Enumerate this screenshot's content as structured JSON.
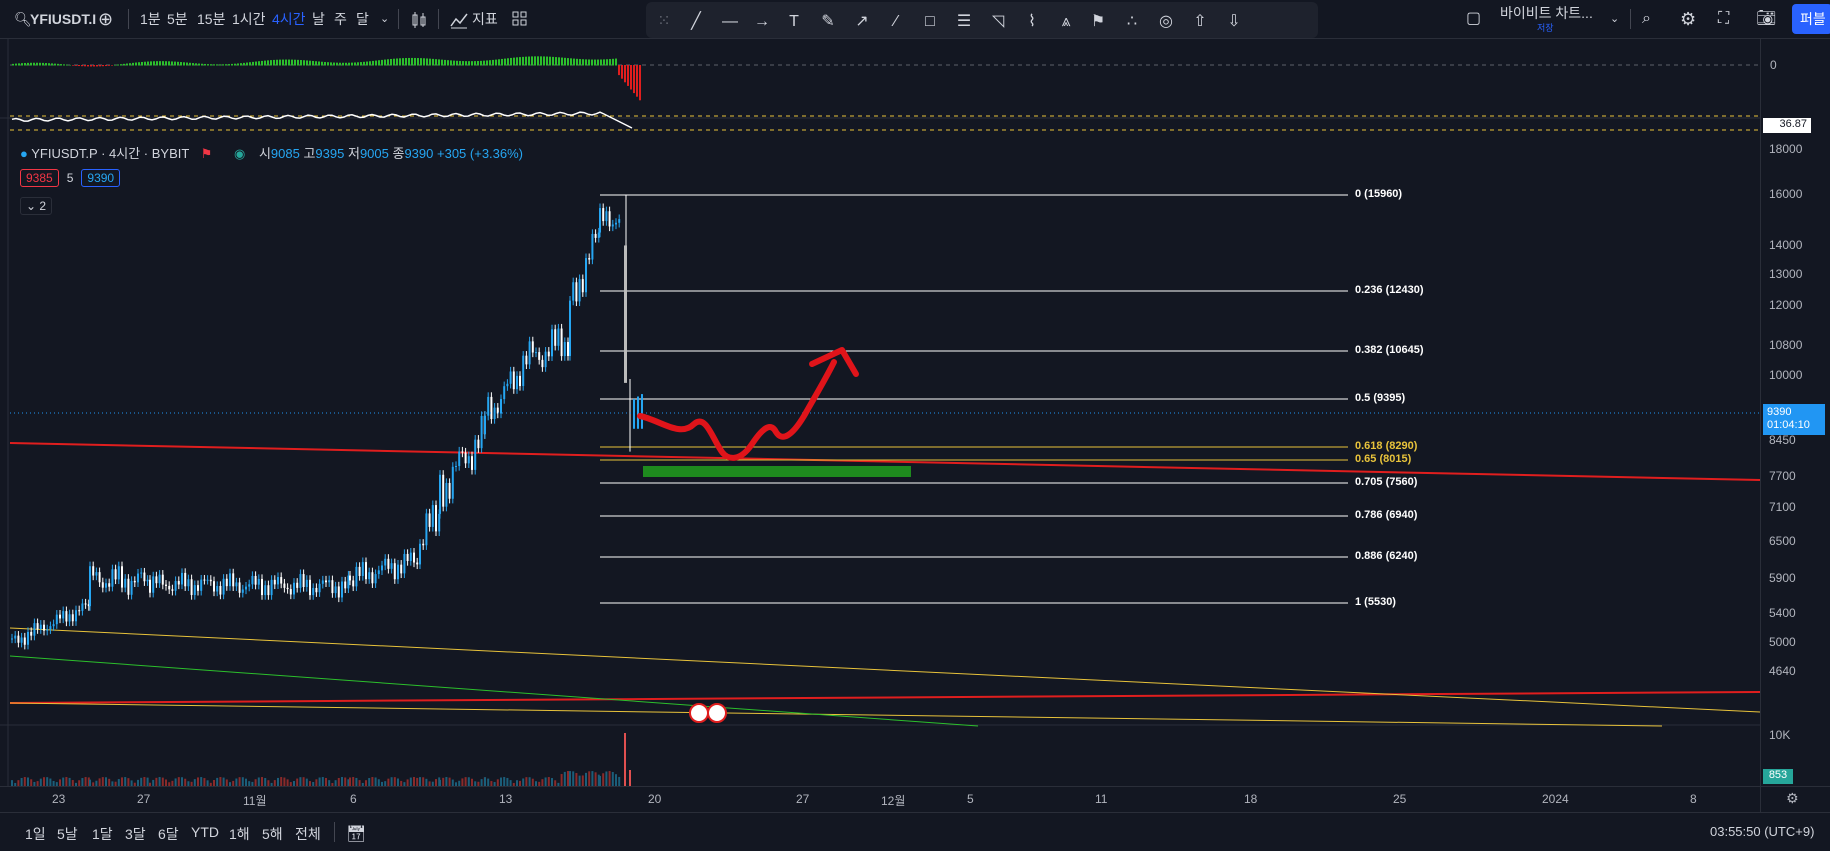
{
  "toolbar": {
    "symbol": "YFIUSDT.I",
    "intervals": [
      "1분",
      "5분",
      "15분",
      "1시간",
      "4시간",
      "날",
      "주",
      "달"
    ],
    "active_interval": "4시간",
    "indicators_label": "지표",
    "layout_name": "바이비트 차트...",
    "layout_sub": "저장",
    "publish_label": "퍼블"
  },
  "legend": {
    "title": "YFIUSDT.P · 4시간 · BYBIT",
    "open_label": "시",
    "open": "9085",
    "high_label": "고",
    "high": "9395",
    "low_label": "저",
    "low": "9005",
    "close_label": "종",
    "close": "9390",
    "change": "+305 (+3.36%)",
    "bid": "9385",
    "spread": "5",
    "ask": "9390",
    "collapse": "2"
  },
  "oscillator": {
    "zero_label": "0",
    "value_label": "36.87"
  },
  "price_scale": {
    "labels": [
      "18000",
      "16000",
      "14000",
      "13000",
      "12000",
      "10800",
      "10000",
      "8450",
      "7700",
      "7100",
      "6500",
      "5900",
      "5400",
      "5000",
      "4640"
    ],
    "current_price": "9390",
    "countdown": "01:04:10"
  },
  "volume": {
    "scale_label": "10K",
    "current_label": "853"
  },
  "fibonacci": [
    {
      "label": "0 (15960)",
      "level": 0,
      "price": 15960
    },
    {
      "label": "0.236 (12430)",
      "level": 0.236,
      "price": 12430
    },
    {
      "label": "0.382 (10645)",
      "level": 0.382,
      "price": 10645
    },
    {
      "label": "0.5 (9395)",
      "level": 0.5,
      "price": 9395
    },
    {
      "label": "0.618 (8290)",
      "level": 0.618,
      "price": 8290
    },
    {
      "label": "0.65 (8015)",
      "level": 0.65,
      "price": 8015
    },
    {
      "label": "0.705 (7560)",
      "level": 0.705,
      "price": 7560
    },
    {
      "label": "0.786 (6940)",
      "level": 0.786,
      "price": 6940
    },
    {
      "label": "0.886 (6240)",
      "level": 0.886,
      "price": 6240
    },
    {
      "label": "1 (5530)",
      "level": 1,
      "price": 5530
    }
  ],
  "time_axis": [
    "23",
    "27",
    "11월",
    "6",
    "13",
    "20",
    "27",
    "12월",
    "5",
    "11",
    "18",
    "25",
    "2024",
    "8"
  ],
  "bottom": {
    "ranges": [
      "1일",
      "5날",
      "1달",
      "3달",
      "6달",
      "YTD",
      "1해",
      "5해",
      "전체"
    ],
    "clock": "03:55:50 (UTC+9)"
  },
  "colors": {
    "background": "#131722",
    "up": "#26a6f2",
    "down": "#ffffff",
    "accent": "#2962ff",
    "trend_red": "#e01e1e",
    "trend_yellow": "#e8c33b",
    "trend_green": "#2cbf2c",
    "zone_green": "#1e8a1e",
    "price_tag": "#2196f3"
  }
}
